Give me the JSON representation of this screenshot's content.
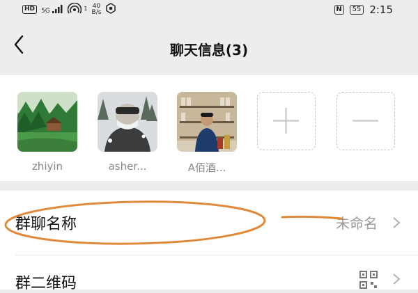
{
  "status_bar": {
    "hd": "HD",
    "signal_label": "5G",
    "wifi_superscript": "1",
    "speed_value": "40",
    "speed_unit": "B/s",
    "nfc": "N",
    "battery": "55",
    "time": "2:15"
  },
  "header": {
    "title": "聊天信息(3)",
    "back_icon": "chevron-left-icon"
  },
  "members": [
    {
      "name": "zhiyin"
    },
    {
      "name": "asher..."
    },
    {
      "name": "A佰酒..."
    }
  ],
  "member_actions": {
    "add_icon": "plus-icon",
    "remove_icon": "minus-icon"
  },
  "rows": {
    "group_name": {
      "label": "群聊名称",
      "value": "未命名"
    },
    "group_qr": {
      "label": "群二维码",
      "icon": "qr-code-icon"
    }
  },
  "annotation": {
    "color": "#e0893a"
  }
}
